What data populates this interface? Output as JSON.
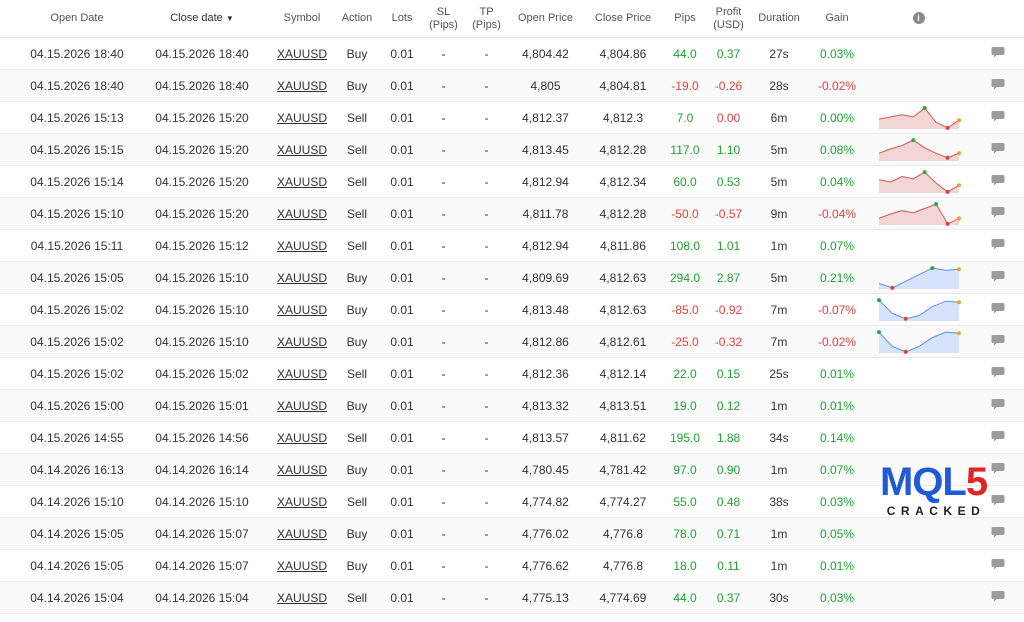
{
  "columns": {
    "open_date": "Open Date",
    "close_date": "Close date",
    "sort_arrow": "▼",
    "symbol": "Symbol",
    "action": "Action",
    "lots": "Lots",
    "sl_line1": "SL",
    "sl_line2": "(Pips)",
    "tp_line1": "TP",
    "tp_line2": "(Pips)",
    "open_price": "Open Price",
    "close_price": "Close Price",
    "pips": "Pips",
    "profit_line1": "Profit",
    "profit_line2": "(USD)",
    "duration": "Duration",
    "gain": "Gain",
    "info": "i"
  },
  "colors": {
    "positive": "#1ea232",
    "negative": "#e0403a",
    "spark_red_line": "#d9534f",
    "spark_red_fill": "#f2d6d6",
    "spark_blue_line": "#5b8ff0",
    "spark_blue_fill": "#d7e3fb",
    "logo_blue": "#1f5bd6",
    "logo_red": "#e02525"
  },
  "logo": {
    "text_a": "MQL",
    "text_b": "5",
    "sub": "CRACKED"
  },
  "trades": [
    {
      "open": "04.15.2026 18:40",
      "close": "04.15.2026 18:40",
      "symbol": "XAUUSD",
      "action": "Buy",
      "lots": "0.01",
      "sl": "-",
      "tp": "-",
      "open_price": "4,804.42",
      "close_price": "4,804.86",
      "pips": "44.0",
      "profit": "0.37",
      "duration": "27s",
      "gain": "0.03%",
      "spark": null
    },
    {
      "open": "04.15.2026 18:40",
      "close": "04.15.2026 18:40",
      "symbol": "XAUUSD",
      "action": "Buy",
      "lots": "0.01",
      "sl": "-",
      "tp": "-",
      "open_price": "4,805",
      "close_price": "4,804.81",
      "pips": "-19.0",
      "profit": "-0.26",
      "duration": "28s",
      "gain": "-0.02%",
      "spark": null
    },
    {
      "open": "04.15.2026 15:13",
      "close": "04.15.2026 15:20",
      "symbol": "XAUUSD",
      "action": "Sell",
      "lots": "0.01",
      "sl": "-",
      "tp": "-",
      "open_price": "4,812.37",
      "close_price": "4,812.3",
      "pips": "7.0",
      "profit": "0.00",
      "duration": "6m",
      "gain": "0.00%",
      "spark": {
        "color": "red",
        "points": [
          0.45,
          0.55,
          0.65,
          0.55,
          0.95,
          0.3,
          0.05,
          0.4
        ]
      }
    },
    {
      "open": "04.15.2026 15:15",
      "close": "04.15.2026 15:20",
      "symbol": "XAUUSD",
      "action": "Sell",
      "lots": "0.01",
      "sl": "-",
      "tp": "-",
      "open_price": "4,813.45",
      "close_price": "4,812.28",
      "pips": "117.0",
      "profit": "1.10",
      "duration": "5m",
      "gain": "0.08%",
      "spark": {
        "color": "red",
        "points": [
          0.35,
          0.55,
          0.7,
          0.95,
          0.6,
          0.35,
          0.15,
          0.35
        ]
      }
    },
    {
      "open": "04.15.2026 15:14",
      "close": "04.15.2026 15:20",
      "symbol": "XAUUSD",
      "action": "Sell",
      "lots": "0.01",
      "sl": "-",
      "tp": "-",
      "open_price": "4,812.94",
      "close_price": "4,812.34",
      "pips": "60.0",
      "profit": "0.53",
      "duration": "5m",
      "gain": "0.04%",
      "spark": {
        "color": "red",
        "points": [
          0.6,
          0.5,
          0.75,
          0.65,
          0.95,
          0.45,
          0.05,
          0.35
        ]
      }
    },
    {
      "open": "04.15.2026 15:10",
      "close": "04.15.2026 15:20",
      "symbol": "XAUUSD",
      "action": "Sell",
      "lots": "0.01",
      "sl": "-",
      "tp": "-",
      "open_price": "4,811.78",
      "close_price": "4,812.28",
      "pips": "-50.0",
      "profit": "-0.57",
      "duration": "9m",
      "gain": "-0.04%",
      "spark": {
        "color": "red",
        "points": [
          0.3,
          0.5,
          0.65,
          0.55,
          0.75,
          0.95,
          0.05,
          0.3
        ]
      }
    },
    {
      "open": "04.15.2026 15:11",
      "close": "04.15.2026 15:12",
      "symbol": "XAUUSD",
      "action": "Sell",
      "lots": "0.01",
      "sl": "-",
      "tp": "-",
      "open_price": "4,812.94",
      "close_price": "4,811.86",
      "pips": "108.0",
      "profit": "1.01",
      "duration": "1m",
      "gain": "0.07%",
      "spark": null
    },
    {
      "open": "04.15.2026 15:05",
      "close": "04.15.2026 15:10",
      "symbol": "XAUUSD",
      "action": "Buy",
      "lots": "0.01",
      "sl": "-",
      "tp": "-",
      "open_price": "4,809.69",
      "close_price": "4,812.63",
      "pips": "294.0",
      "profit": "2.87",
      "duration": "5m",
      "gain": "0.21%",
      "spark": {
        "color": "blue",
        "points": [
          0.25,
          0.05,
          0.35,
          0.65,
          0.95,
          0.85,
          0.9
        ]
      }
    },
    {
      "open": "04.15.2026 15:02",
      "close": "04.15.2026 15:10",
      "symbol": "XAUUSD",
      "action": "Buy",
      "lots": "0.01",
      "sl": "-",
      "tp": "-",
      "open_price": "4,813.48",
      "close_price": "4,812.63",
      "pips": "-85.0",
      "profit": "-0.92",
      "duration": "7m",
      "gain": "-0.07%",
      "spark": {
        "color": "blue",
        "points": [
          0.95,
          0.35,
          0.1,
          0.25,
          0.65,
          0.9,
          0.85
        ]
      }
    },
    {
      "open": "04.15.2026 15:02",
      "close": "04.15.2026 15:10",
      "symbol": "XAUUSD",
      "action": "Buy",
      "lots": "0.01",
      "sl": "-",
      "tp": "-",
      "open_price": "4,812.86",
      "close_price": "4,812.61",
      "pips": "-25.0",
      "profit": "-0.32",
      "duration": "7m",
      "gain": "-0.02%",
      "spark": {
        "color": "blue",
        "points": [
          0.95,
          0.3,
          0.05,
          0.3,
          0.7,
          0.95,
          0.9
        ]
      }
    },
    {
      "open": "04.15.2026 15:02",
      "close": "04.15.2026 15:02",
      "symbol": "XAUUSD",
      "action": "Sell",
      "lots": "0.01",
      "sl": "-",
      "tp": "-",
      "open_price": "4,812.36",
      "close_price": "4,812.14",
      "pips": "22.0",
      "profit": "0.15",
      "duration": "25s",
      "gain": "0.01%",
      "spark": null
    },
    {
      "open": "04.15.2026 15:00",
      "close": "04.15.2026 15:01",
      "symbol": "XAUUSD",
      "action": "Buy",
      "lots": "0.01",
      "sl": "-",
      "tp": "-",
      "open_price": "4,813.32",
      "close_price": "4,813.51",
      "pips": "19.0",
      "profit": "0.12",
      "duration": "1m",
      "gain": "0.01%",
      "spark": null
    },
    {
      "open": "04.15.2026 14:55",
      "close": "04.15.2026 14:56",
      "symbol": "XAUUSD",
      "action": "Sell",
      "lots": "0.01",
      "sl": "-",
      "tp": "-",
      "open_price": "4,813.57",
      "close_price": "4,811.62",
      "pips": "195.0",
      "profit": "1.88",
      "duration": "34s",
      "gain": "0.14%",
      "spark": null
    },
    {
      "open": "04.14.2026 16:13",
      "close": "04.14.2026 16:14",
      "symbol": "XAUUSD",
      "action": "Buy",
      "lots": "0.01",
      "sl": "-",
      "tp": "-",
      "open_price": "4,780.45",
      "close_price": "4,781.42",
      "pips": "97.0",
      "profit": "0.90",
      "duration": "1m",
      "gain": "0.07%",
      "spark": null
    },
    {
      "open": "04.14.2026 15:10",
      "close": "04.14.2026 15:10",
      "symbol": "XAUUSD",
      "action": "Sell",
      "lots": "0.01",
      "sl": "-",
      "tp": "-",
      "open_price": "4,774.82",
      "close_price": "4,774.27",
      "pips": "55.0",
      "profit": "0.48",
      "duration": "38s",
      "gain": "0.03%",
      "spark": null
    },
    {
      "open": "04.14.2026 15:05",
      "close": "04.14.2026 15:07",
      "symbol": "XAUUSD",
      "action": "Buy",
      "lots": "0.01",
      "sl": "-",
      "tp": "-",
      "open_price": "4,776.02",
      "close_price": "4,776.8",
      "pips": "78.0",
      "profit": "0.71",
      "duration": "1m",
      "gain": "0.05%",
      "spark": null
    },
    {
      "open": "04.14.2026 15:05",
      "close": "04.14.2026 15:07",
      "symbol": "XAUUSD",
      "action": "Buy",
      "lots": "0.01",
      "sl": "-",
      "tp": "-",
      "open_price": "4,776.62",
      "close_price": "4,776.8",
      "pips": "18.0",
      "profit": "0.11",
      "duration": "1m",
      "gain": "0.01%",
      "spark": null
    },
    {
      "open": "04.14.2026 15:04",
      "close": "04.14.2026 15:04",
      "symbol": "XAUUSD",
      "action": "Sell",
      "lots": "0.01",
      "sl": "-",
      "tp": "-",
      "open_price": "4,775.13",
      "close_price": "4,774.69",
      "pips": "44.0",
      "profit": "0.37",
      "duration": "30s",
      "gain": "0.03%",
      "spark": null
    }
  ]
}
